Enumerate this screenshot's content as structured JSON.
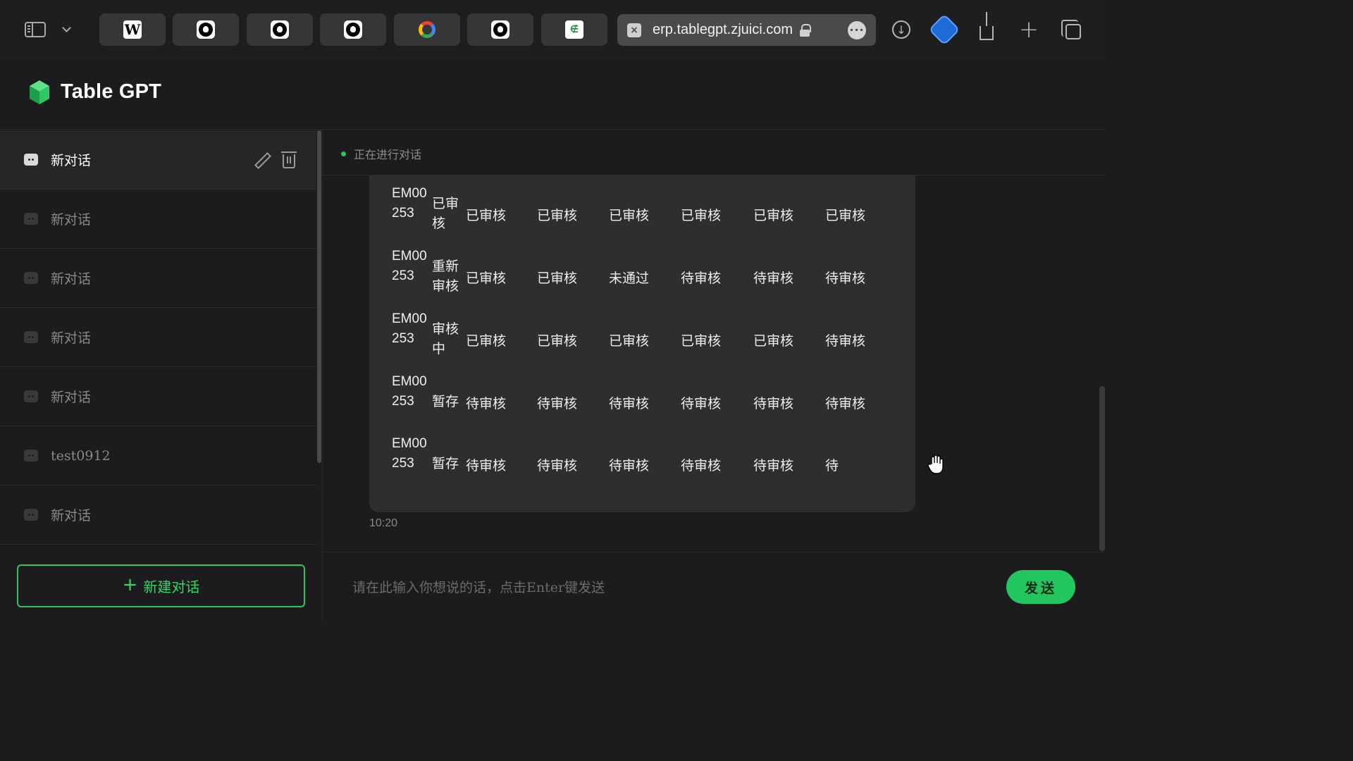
{
  "browser": {
    "tabs": [
      {
        "icon": "wikipedia-icon",
        "glyph": "W"
      },
      {
        "icon": "github-icon"
      },
      {
        "icon": "github-icon"
      },
      {
        "icon": "github-icon"
      },
      {
        "icon": "google-icon"
      },
      {
        "icon": "github-icon"
      },
      {
        "icon": "geeksforgeeks-icon",
        "glyph": "∉"
      }
    ],
    "url": "erp.tablegpt.zjuici.com"
  },
  "app": {
    "brand": "Table GPT",
    "accent_color": "#22c55e"
  },
  "sidebar": {
    "items": [
      {
        "label": "新对话",
        "active": true
      },
      {
        "label": "新对话"
      },
      {
        "label": "新对话"
      },
      {
        "label": "新对话"
      },
      {
        "label": "新对话"
      },
      {
        "label": "test0912"
      },
      {
        "label": "新对话"
      }
    ],
    "new_chat_label": "新建对话"
  },
  "chat": {
    "status": "正在进行对话",
    "table": {
      "rows": [
        {
          "id": "EM00253",
          "status": "已审核",
          "cells": [
            "已审核",
            "已审核",
            "已审核",
            "已审核",
            "已审核",
            "已审核"
          ]
        },
        {
          "id": "EM00253",
          "status": "重新审核",
          "cells": [
            "已审核",
            "已审核",
            "未通过",
            "待审核",
            "待审核",
            "待审核"
          ]
        },
        {
          "id": "EM00253",
          "status": "审核中",
          "cells": [
            "已审核",
            "已审核",
            "已审核",
            "已审核",
            "已审核",
            "待审核"
          ]
        },
        {
          "id": "EM00253",
          "status": "暂存",
          "cells": [
            "待审核",
            "待审核",
            "待审核",
            "待审核",
            "待审核",
            "待审核"
          ]
        },
        {
          "id": "EM00253",
          "status": "暂存",
          "cells": [
            "待审核",
            "待审核",
            "待审核",
            "待审核",
            "待审核",
            "待"
          ]
        }
      ]
    },
    "time": "10:20",
    "input_placeholder": "请在此输入你想说的话，点击Enter键发送",
    "send_label": "发送"
  }
}
